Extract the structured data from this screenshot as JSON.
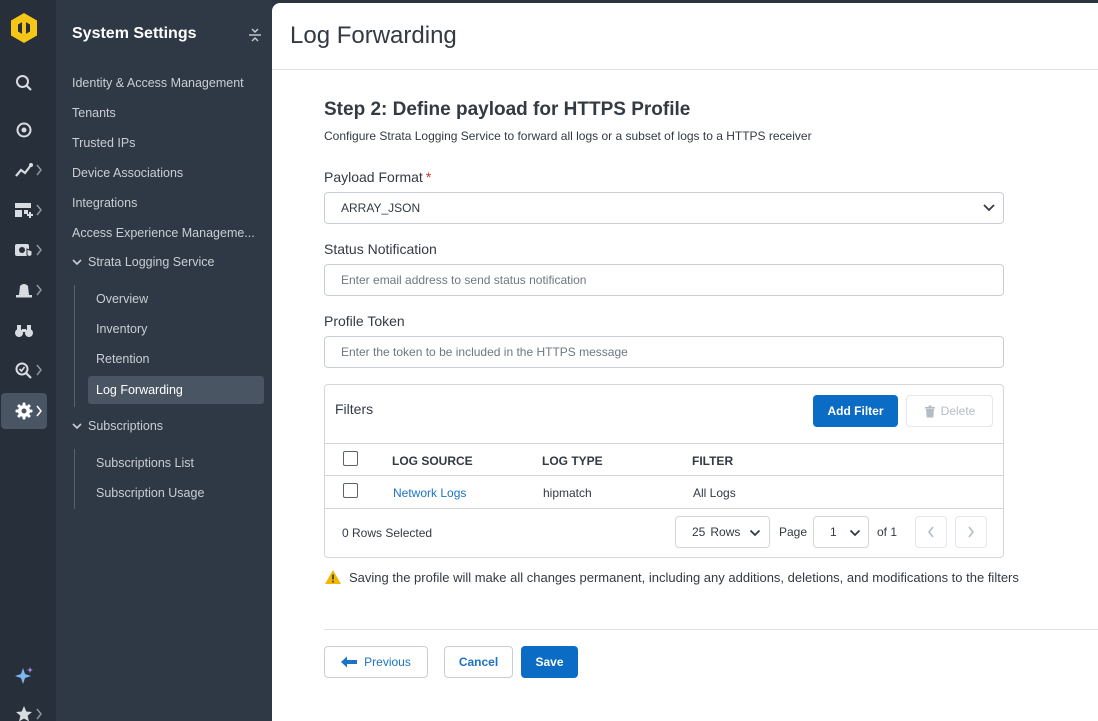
{
  "rail": {
    "items": [
      {
        "icon": "search-icon"
      },
      {
        "icon": "target-icon"
      },
      {
        "icon": "analytics-icon"
      },
      {
        "icon": "dashboard-icon"
      },
      {
        "icon": "security-services-icon"
      },
      {
        "icon": "alerts-icon"
      },
      {
        "icon": "binoculars-icon"
      },
      {
        "icon": "investigate-icon"
      },
      {
        "icon": "settings-gear-icon"
      },
      {
        "icon": "ai-sparkle-icon"
      },
      {
        "icon": "star-icon"
      }
    ],
    "accent_color": "#f5c518"
  },
  "nav": {
    "title": "System Settings",
    "items": [
      "Identity & Access Management",
      "Tenants",
      "Trusted IPs",
      "Device Associations",
      "Integrations",
      "Access Experience Manageme..."
    ],
    "groups": [
      {
        "label": "Strata Logging Service",
        "children": [
          "Overview",
          "Inventory",
          "Retention",
          "Log Forwarding"
        ]
      },
      {
        "label": "Subscriptions",
        "children": [
          "Subscriptions List",
          "Subscription Usage"
        ]
      }
    ],
    "active": "Log Forwarding"
  },
  "main": {
    "page_title": "Log Forwarding",
    "step_title": "Step 2: Define payload for HTTPS Profile",
    "step_subtitle": "Configure Strata Logging Service to forward all logs or a subset of logs to a HTTPS receiver",
    "payload_format": {
      "label": "Payload Format",
      "required_mark": "*",
      "value": "ARRAY_JSON"
    },
    "status_notification": {
      "label": "Status Notification",
      "placeholder": "Enter email address to send status notification",
      "value": ""
    },
    "profile_token": {
      "label": "Profile Token",
      "placeholder": "Enter the token to be included in the HTTPS message",
      "value": ""
    },
    "filters": {
      "label": "Filters",
      "add_button": "Add Filter",
      "delete_button": "Delete",
      "columns": [
        "LOG SOURCE",
        "LOG TYPE",
        "FILTER"
      ],
      "rows": [
        {
          "log_source": "Network Logs",
          "log_type": "hipmatch",
          "filter": "All Logs"
        }
      ],
      "rows_selected": "0 Rows Selected",
      "rows_per_page": "25",
      "rows_word": "Rows",
      "page_label": "Page",
      "page_value": "1",
      "page_of": "of 1"
    },
    "warning": "Saving the profile will make all changes permanent, including any additions, deletions, and modifications to the filters",
    "buttons": {
      "previous": "Previous",
      "cancel": "Cancel",
      "save": "Save"
    },
    "colors": {
      "primary": "#0a6cc4",
      "link": "#1a73c8",
      "warning": "#f2b705",
      "required": "#d93025"
    }
  }
}
